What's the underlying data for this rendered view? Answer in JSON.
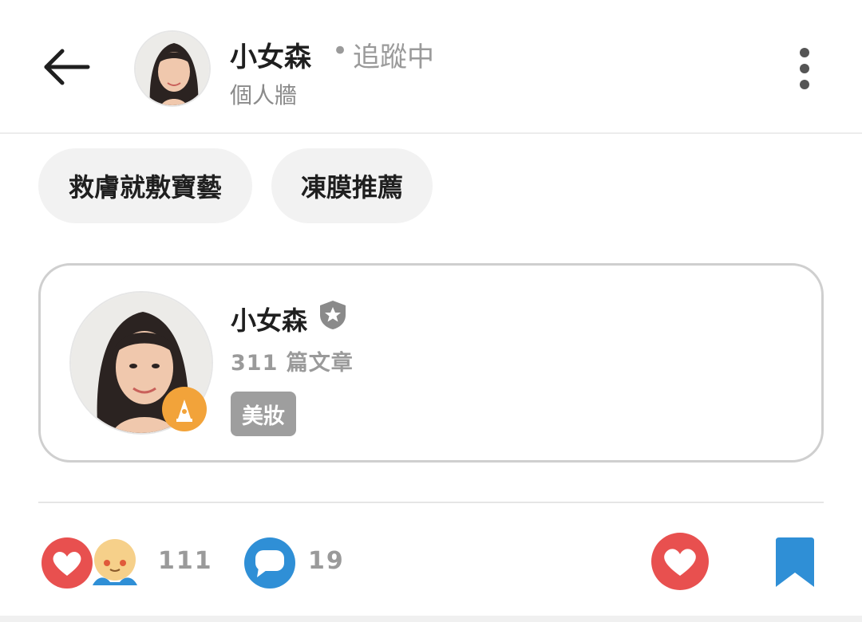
{
  "header": {
    "name": "小女森",
    "separator": "•",
    "follow_status": "追蹤中",
    "subtitle": "個人牆",
    "back_icon": "arrow-left-icon",
    "more_icon": "more-vertical-icon"
  },
  "tags": [
    {
      "label": "救膚就敷寶藝"
    },
    {
      "label": "凍膜推薦"
    }
  ],
  "author_card": {
    "name": "小女森",
    "verified_icon": "shield-star-icon",
    "post_count": "311 篇文章",
    "category": "美妝",
    "badge_icon": "pen-nib-icon"
  },
  "actions": {
    "like_count": "111",
    "comment_count": "19",
    "reaction_icons": [
      "heart-icon",
      "emoji-icon"
    ],
    "comment_icon": "speech-bubble-icon",
    "like_button_icon": "heart-icon",
    "bookmark_icon": "bookmark-icon"
  },
  "colors": {
    "like_red": "#e8504f",
    "comment_blue": "#2f8fd6",
    "bookmark_blue": "#2f8fd6",
    "badge_orange": "#f2a33a",
    "verified_gray": "#8a8a8a"
  }
}
